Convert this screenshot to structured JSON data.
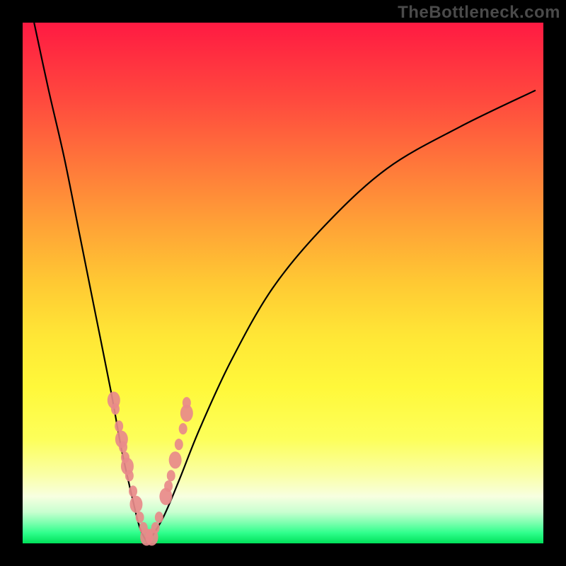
{
  "watermark": "TheBottleneck.com",
  "chart_data": {
    "type": "line",
    "title": "",
    "xlabel": "",
    "ylabel": "",
    "xlim": [
      0,
      1
    ],
    "ylim": [
      0,
      1
    ],
    "note": "Axes are unlabeled; values are normalized 0–1 positions read from pixel geometry. A single black V-shaped curve with its minimum near the bottom at x≈0.24. Salmon-colored marker clusters lie on the two arms of the V near the bottom.",
    "series": [
      {
        "name": "curve-left",
        "x": [
          0.022,
          0.05,
          0.08,
          0.11,
          0.14,
          0.17,
          0.19,
          0.21,
          0.225,
          0.24
        ],
        "y": [
          1.0,
          0.87,
          0.74,
          0.59,
          0.44,
          0.29,
          0.18,
          0.09,
          0.03,
          0.0
        ]
      },
      {
        "name": "curve-right",
        "x": [
          0.24,
          0.27,
          0.3,
          0.34,
          0.4,
          0.48,
          0.58,
          0.7,
          0.84,
          0.985
        ],
        "y": [
          0.0,
          0.05,
          0.12,
          0.22,
          0.35,
          0.49,
          0.61,
          0.72,
          0.8,
          0.87
        ]
      }
    ],
    "markers": {
      "color": "#e88a8a",
      "left_cluster": [
        [
          0.175,
          0.275
        ],
        [
          0.178,
          0.258
        ],
        [
          0.185,
          0.225
        ],
        [
          0.19,
          0.2
        ],
        [
          0.193,
          0.185
        ],
        [
          0.197,
          0.165
        ],
        [
          0.201,
          0.148
        ],
        [
          0.205,
          0.13
        ],
        [
          0.212,
          0.1
        ],
        [
          0.218,
          0.075
        ],
        [
          0.225,
          0.05
        ],
        [
          0.232,
          0.03
        ],
        [
          0.238,
          0.012
        ]
      ],
      "right_cluster": [
        [
          0.248,
          0.012
        ],
        [
          0.255,
          0.03
        ],
        [
          0.262,
          0.05
        ],
        [
          0.275,
          0.09
        ],
        [
          0.28,
          0.11
        ],
        [
          0.285,
          0.13
        ],
        [
          0.293,
          0.16
        ],
        [
          0.3,
          0.19
        ],
        [
          0.308,
          0.22
        ],
        [
          0.315,
          0.25
        ],
        [
          0.315,
          0.27
        ]
      ]
    }
  }
}
